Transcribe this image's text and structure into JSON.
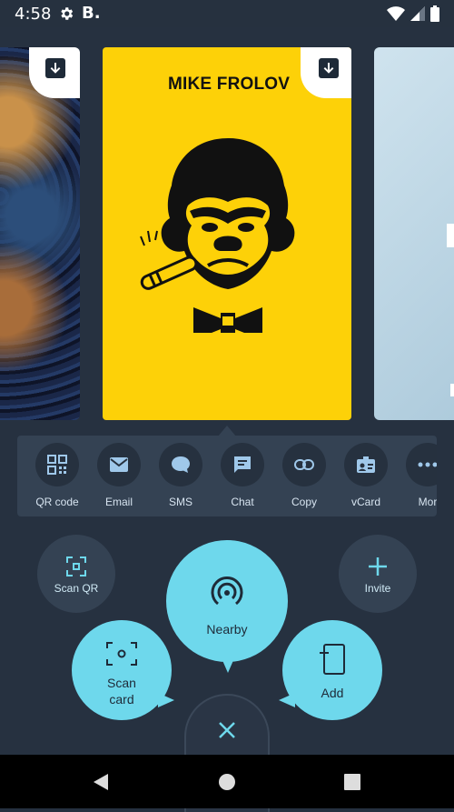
{
  "status_bar": {
    "time": "4:58",
    "app_badge": "B."
  },
  "cards": {
    "main": {
      "name": "MIKE FROLOV",
      "accent": "#fdd108"
    }
  },
  "share": {
    "items": [
      {
        "label": "QR code",
        "icon": "qr-code-icon"
      },
      {
        "label": "Email",
        "icon": "email-icon"
      },
      {
        "label": "SMS",
        "icon": "sms-icon"
      },
      {
        "label": "Chat",
        "icon": "chat-icon"
      },
      {
        "label": "Copy",
        "icon": "link-icon"
      },
      {
        "label": "vCard",
        "icon": "vcard-icon"
      },
      {
        "label": "Mor",
        "icon": "more-icon"
      }
    ]
  },
  "actions": {
    "scan_qr": "Scan QR",
    "invite": "Invite",
    "nearby": "Nearby",
    "scan_card_line1": "Scan",
    "scan_card_line2": "card",
    "add": "Add"
  },
  "colors": {
    "background": "#263140",
    "panel": "#344253",
    "fab": "#6ed8ec"
  }
}
